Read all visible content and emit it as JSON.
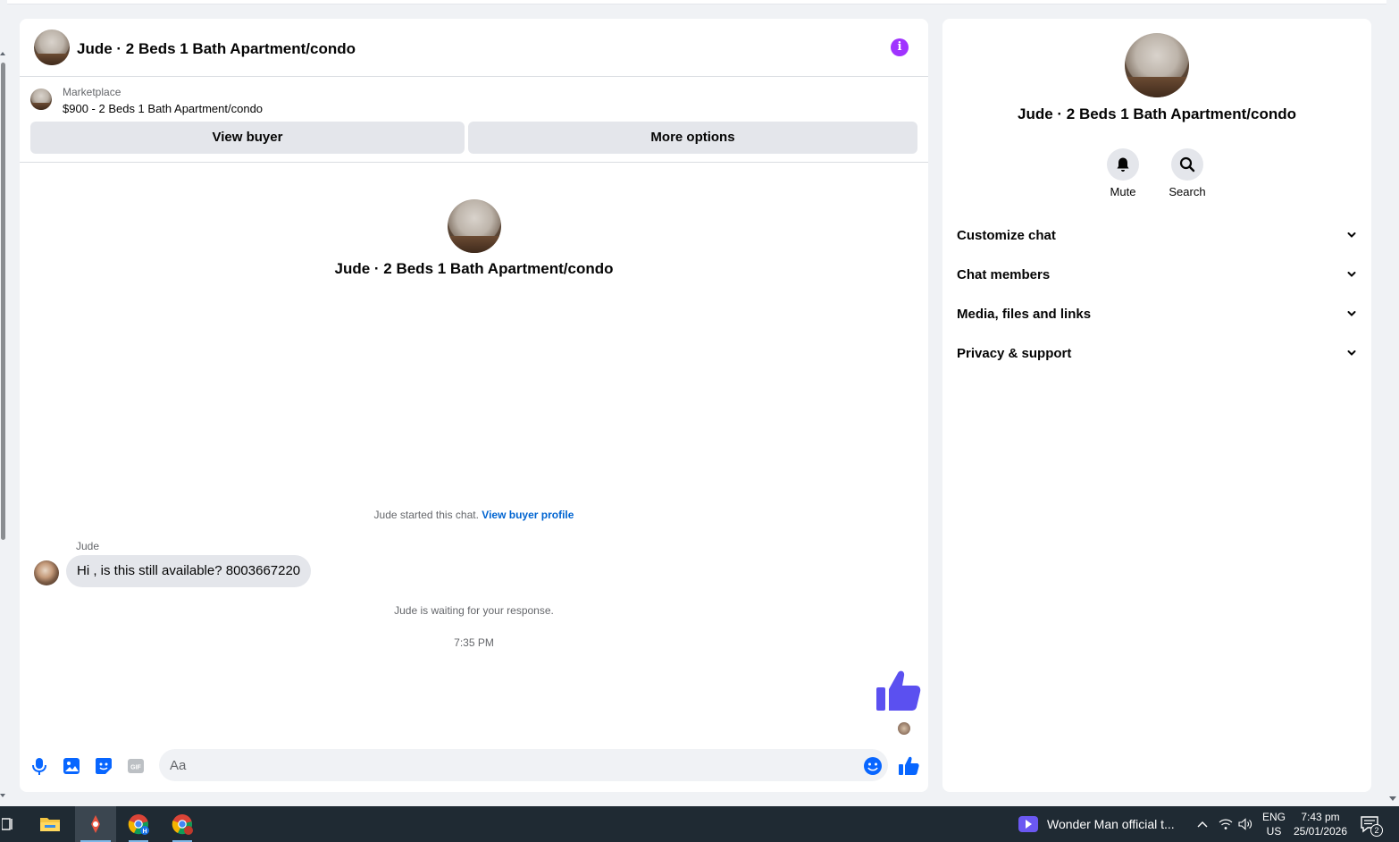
{
  "chat": {
    "title": "Jude · 2 Beds 1 Bath Apartment/condo",
    "marketplace_label": "Marketplace",
    "listing": "$900 - 2 Beds 1 Bath Apartment/condo",
    "view_buyer_label": "View buyer",
    "more_options_label": "More options",
    "intro_title": "Jude · 2 Beds 1 Bath Apartment/condo",
    "started_text": "Jude started this chat.",
    "view_profile_link": "View buyer profile",
    "sender_name": "Jude",
    "message": "Hi , is this still available? 8003667220",
    "waiting_text": "Jude is waiting for your response.",
    "timestamp": "7:35 PM",
    "composer_placeholder": "Aa"
  },
  "info_panel": {
    "title": "Jude · 2 Beds 1 Bath Apartment/condo",
    "mute_label": "Mute",
    "search_label": "Search",
    "sections": [
      {
        "label": "Customize chat"
      },
      {
        "label": "Chat members"
      },
      {
        "label": "Media, files and links"
      },
      {
        "label": "Privacy & support"
      }
    ]
  },
  "taskbar": {
    "media_title": "Wonder Man official t...",
    "lang_line1": "ENG",
    "lang_line2": "US",
    "time": "7:43 pm",
    "date": "25/01/2026",
    "notification_count": "2"
  },
  "colors": {
    "accent": "#0866ff",
    "like_purple": "#5b50f0",
    "info_purple": "#a033ff",
    "link": "#0064d1"
  }
}
